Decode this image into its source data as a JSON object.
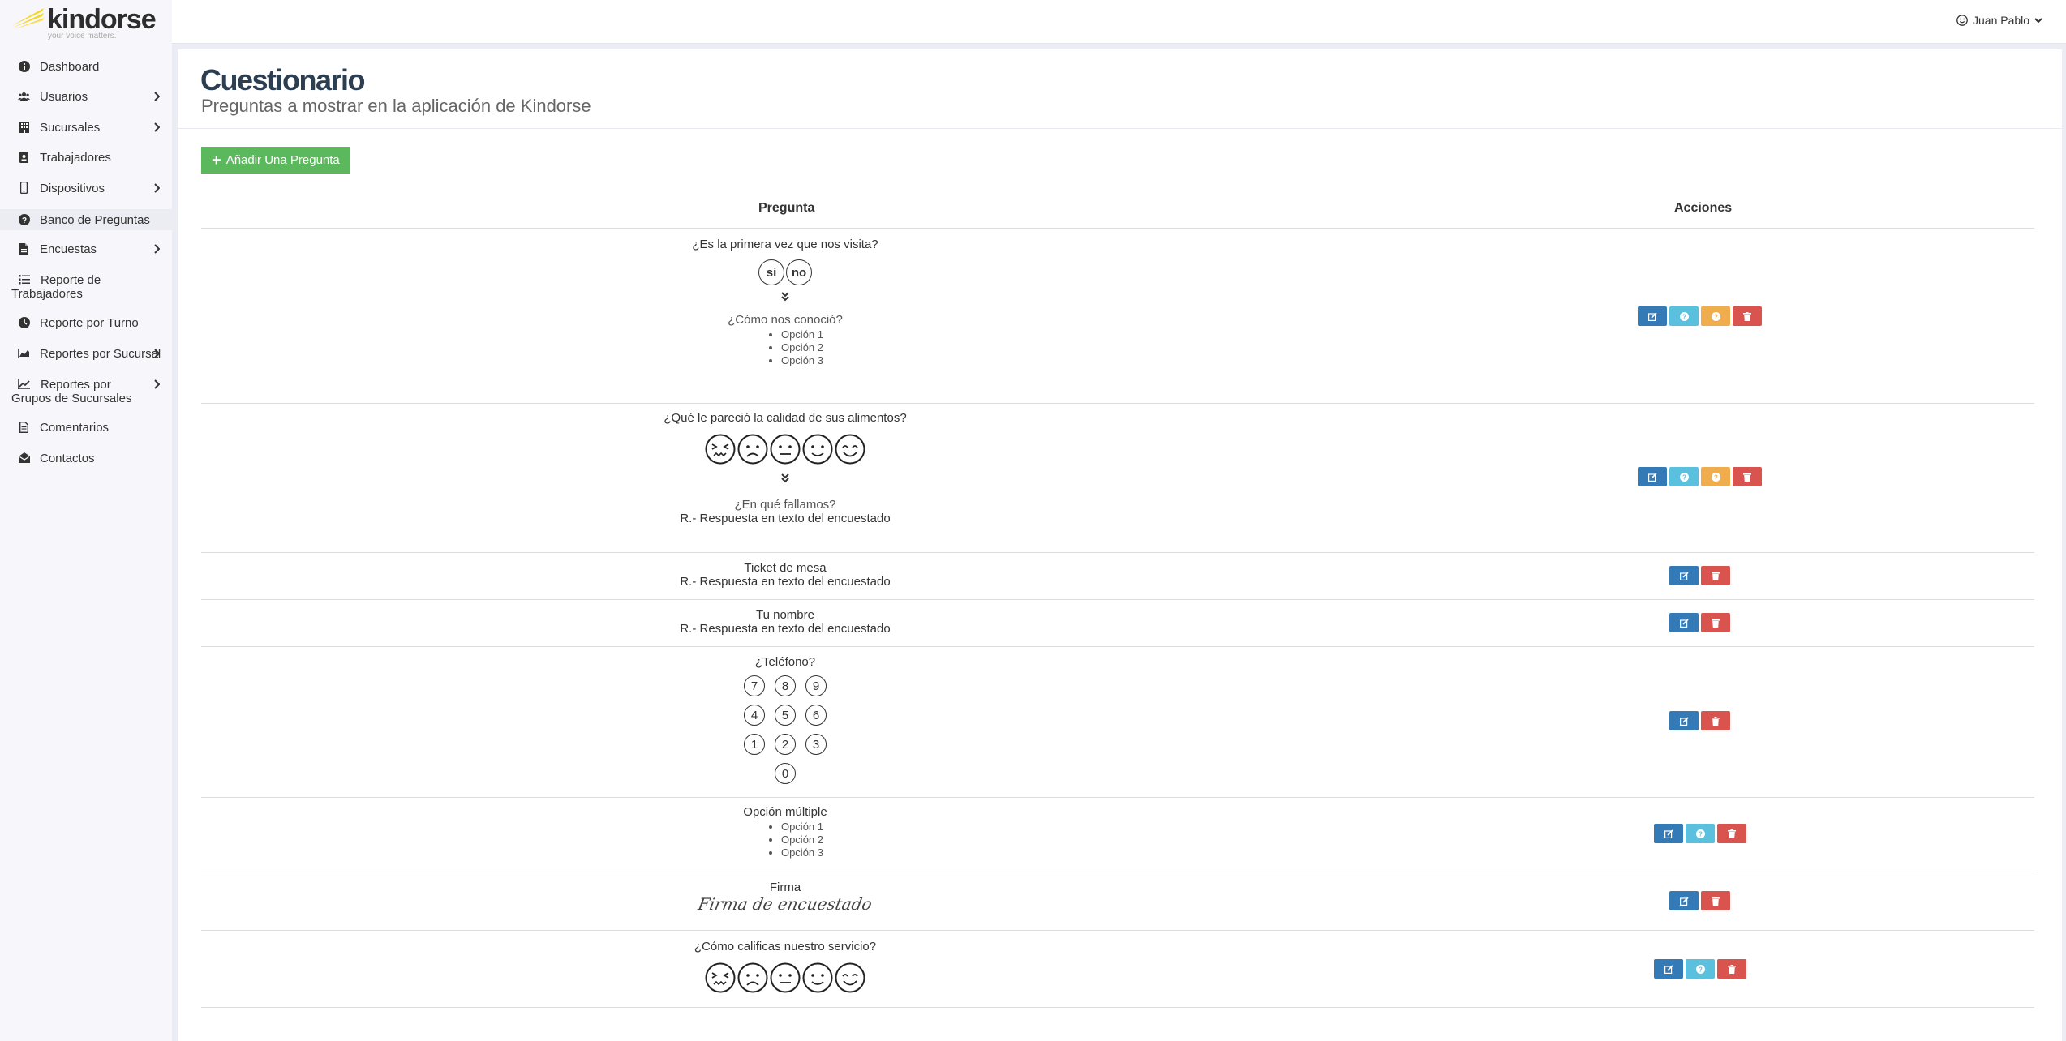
{
  "brand": {
    "name": "kindorse",
    "tagline": "your voice matters."
  },
  "sidebar": {
    "items": [
      {
        "label": "Dashboard",
        "icon": "info-circle-icon",
        "has_children": false
      },
      {
        "label": "Usuarios",
        "icon": "users-icon",
        "has_children": true
      },
      {
        "label": "Sucursales",
        "icon": "building-icon",
        "has_children": true
      },
      {
        "label": "Trabajadores",
        "icon": "id-badge-icon",
        "has_children": false
      },
      {
        "label": "Dispositivos",
        "icon": "mobile-icon",
        "has_children": true
      },
      {
        "label": "Banco de Preguntas",
        "icon": "question-circle-icon",
        "has_children": false,
        "active": true
      },
      {
        "label": "Encuestas",
        "icon": "file-icon",
        "has_children": true
      },
      {
        "label": "Reporte de Trabajadores",
        "icon": "list-icon",
        "has_children": false
      },
      {
        "label": "Reporte por Turno",
        "icon": "clock-icon",
        "has_children": false
      },
      {
        "label": "Reportes por Sucursal",
        "icon": "area-chart-icon",
        "has_children": true
      },
      {
        "label": "Reportes por Grupos de Sucursales",
        "icon": "line-chart-icon",
        "has_children": true
      },
      {
        "label": "Comentarios",
        "icon": "file-text-icon",
        "has_children": false
      },
      {
        "label": "Contactos",
        "icon": "envelope-open-icon",
        "has_children": false
      }
    ]
  },
  "topbar": {
    "user_name": "Juan Pablo"
  },
  "page": {
    "title": "Cuestionario",
    "subtitle": "Preguntas a mostrar en la aplicación de Kindorse",
    "add_button": "Añadir Una Pregunta"
  },
  "table": {
    "headers": {
      "question": "Pregunta",
      "actions": "Acciones"
    },
    "rows": [
      {
        "question": "¿Es la primera vez que nos visita?",
        "answer_type": "yes-no",
        "choices": [
          "si",
          "no"
        ],
        "follow_up": "¿Cómo nos conoció?",
        "follow_up_options": [
          "Opción 1",
          "Opción 2",
          "Opción 3"
        ],
        "actions": [
          "edit",
          "help",
          "condition",
          "delete"
        ]
      },
      {
        "question": "¿Qué le pareció la calidad de sus alimentos?",
        "answer_type": "faces",
        "follow_up": "¿En qué fallamos?",
        "follow_up_response": "R.- Respuesta en texto del encuestado",
        "actions": [
          "edit",
          "help",
          "condition",
          "delete"
        ]
      },
      {
        "question": "Ticket de mesa",
        "answer_type": "text",
        "response": "R.- Respuesta en texto del encuestado",
        "actions": [
          "edit",
          "delete"
        ]
      },
      {
        "question": "Tu nombre",
        "answer_type": "text",
        "response": "R.- Respuesta en texto del encuestado",
        "actions": [
          "edit",
          "delete"
        ]
      },
      {
        "question": "¿Teléfono?",
        "answer_type": "keypad",
        "keypad": [
          [
            "7",
            "8",
            "9"
          ],
          [
            "4",
            "5",
            "6"
          ],
          [
            "1",
            "2",
            "3"
          ],
          [
            "0"
          ]
        ],
        "actions": [
          "edit",
          "delete"
        ]
      },
      {
        "question": "Opción múltiple",
        "answer_type": "multiple-choice",
        "options": [
          "Opción 1",
          "Opción 2",
          "Opción 3"
        ],
        "actions": [
          "edit",
          "help",
          "delete"
        ]
      },
      {
        "question": "Firma",
        "answer_type": "signature",
        "signature_text": "Firma de encuestado",
        "actions": [
          "edit",
          "delete"
        ]
      },
      {
        "question": "¿Cómo calificas nuestro servicio?",
        "answer_type": "faces",
        "actions": [
          "edit",
          "help",
          "delete"
        ]
      }
    ]
  },
  "colors": {
    "edit": "#337ab7",
    "help": "#5bc0de",
    "condition": "#f0ad4e",
    "delete": "#d9534f",
    "add": "#5cb85c",
    "logo": "#f5d61b"
  }
}
